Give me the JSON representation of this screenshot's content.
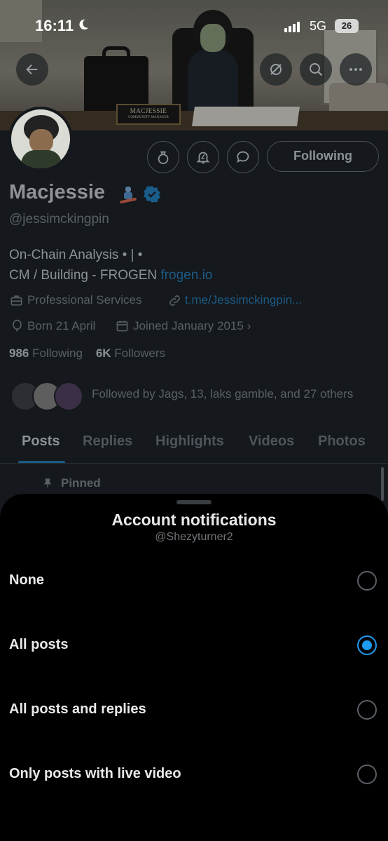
{
  "status_bar": {
    "time": "16:11",
    "network": "5G",
    "battery": "26"
  },
  "banner": {
    "nameplate_name": "MACJESSIE",
    "nameplate_role": "COMMUNITY MANAGER"
  },
  "profile": {
    "name": "Macjessie",
    "handle": "@jessimckingpin",
    "bio_line1": "On-Chain Analysis • | •",
    "bio_line2_text": "CM / Building - FROGEN ",
    "bio_line2_link": "frogen.io",
    "category": "Professional Services",
    "website": "t.me/Jessimckingpin...",
    "born": "Born 21 April",
    "joined": "Joined January 2015",
    "following_count": "986",
    "following_label": "Following",
    "followers_count": "6K",
    "followers_label": "Followers",
    "followed_by": "Followed by Jags, 13, laks gamble, and 27 others",
    "follow_button": "Following"
  },
  "tabs": [
    "Posts",
    "Replies",
    "Highlights",
    "Videos",
    "Photos"
  ],
  "active_tab": "Posts",
  "pinned_label": "Pinned",
  "sheet": {
    "title": "Account notifications",
    "subtitle": "@Shezyturner2",
    "options": [
      {
        "label": "None",
        "selected": false
      },
      {
        "label": "All posts",
        "selected": true
      },
      {
        "label": "All posts and replies",
        "selected": false
      },
      {
        "label": "Only posts with live video",
        "selected": false
      }
    ]
  },
  "colors": {
    "accent": "#1d9bf0",
    "background": "#000000",
    "dimmed_page": "#15181c"
  },
  "icons": [
    "back-arrow-icon",
    "hide-icon",
    "search-icon",
    "more-icon",
    "tip-icon",
    "bell-icon",
    "message-icon",
    "verified-icon",
    "briefcase-icon",
    "link-icon",
    "balloon-icon",
    "calendar-icon",
    "pin-icon"
  ]
}
